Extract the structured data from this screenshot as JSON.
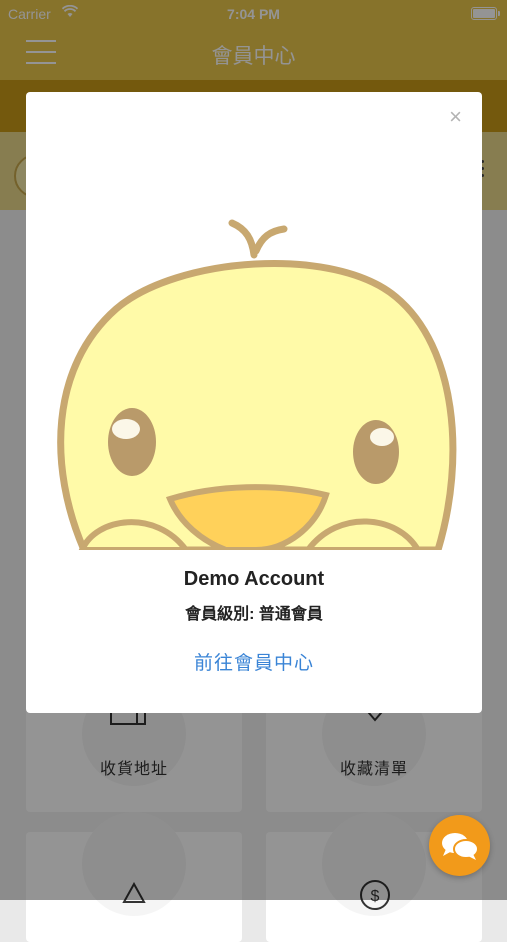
{
  "status_bar": {
    "carrier": "Carrier",
    "time": "7:04 PM"
  },
  "nav": {
    "title": "會員中心"
  },
  "tiles": [
    {
      "label": "收貨地址",
      "icon": "wallet-icon"
    },
    {
      "label": "收藏清單",
      "icon": "heart-icon"
    },
    {
      "label": "",
      "icon": "warning-icon"
    },
    {
      "label": "",
      "icon": "dollar-icon"
    }
  ],
  "modal": {
    "close": "×",
    "account_name": "Demo Account",
    "member_level": "會員級別: 普通會員",
    "goto_link": "前往會員中心"
  },
  "colors": {
    "header": "#e9c64a",
    "band": "#c89a18",
    "link": "#3a84d6",
    "fab": "#f29a1a",
    "duck_body": "#fffaa8",
    "duck_outline": "#c8a870"
  }
}
